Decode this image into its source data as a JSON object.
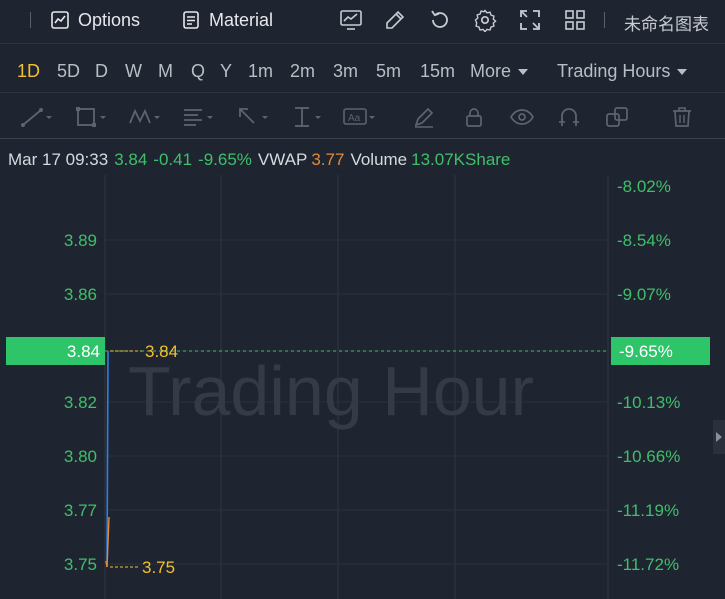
{
  "toolbar": {
    "options_label": "Options",
    "material_label": "Material",
    "template_label": "未命名图表"
  },
  "intervals": {
    "items": [
      "1D",
      "5D",
      "D",
      "W",
      "M",
      "Q",
      "Y",
      "1m",
      "2m",
      "3m",
      "5m",
      "15m"
    ],
    "active": "1D",
    "more_label": "More",
    "session_label": "Trading Hours"
  },
  "info": {
    "datetime": "Mar 17 09:33",
    "price": "3.84",
    "change": "-0.41",
    "change_pct": "-9.65%",
    "vwap_label": "VWAP",
    "vwap_value": "3.77",
    "volume_label": "Volume",
    "volume_value": "13.07KShare"
  },
  "chart": {
    "watermark": "Trading Hour",
    "current_price_label": "3.84",
    "current_pct_label": "-9.65%",
    "high_marker": "3.84",
    "low_marker": "3.75",
    "colors": {
      "up": "#3fbf6a",
      "price_line": "#2f7fe0",
      "vwap_line": "#e08a3a",
      "marker": "#f2c12e",
      "badge": "#2ec46a"
    }
  },
  "chart_data": {
    "type": "line",
    "y_ticks": [
      "3.89",
      "3.86",
      "3.84",
      "3.82",
      "3.80",
      "3.77",
      "3.75"
    ],
    "y2_ticks": [
      "-8.02%",
      "-8.54%",
      "-9.07%",
      "-9.65%",
      "-10.13%",
      "-10.66%",
      "-11.19%",
      "-11.72%"
    ],
    "ylim": [
      3.745,
      3.905
    ],
    "series": [
      {
        "name": "",
        "values": [
          3.75,
          3.84
        ]
      },
      {
        "name": "VWAP",
        "values": [
          3.75,
          3.77
        ]
      }
    ]
  }
}
